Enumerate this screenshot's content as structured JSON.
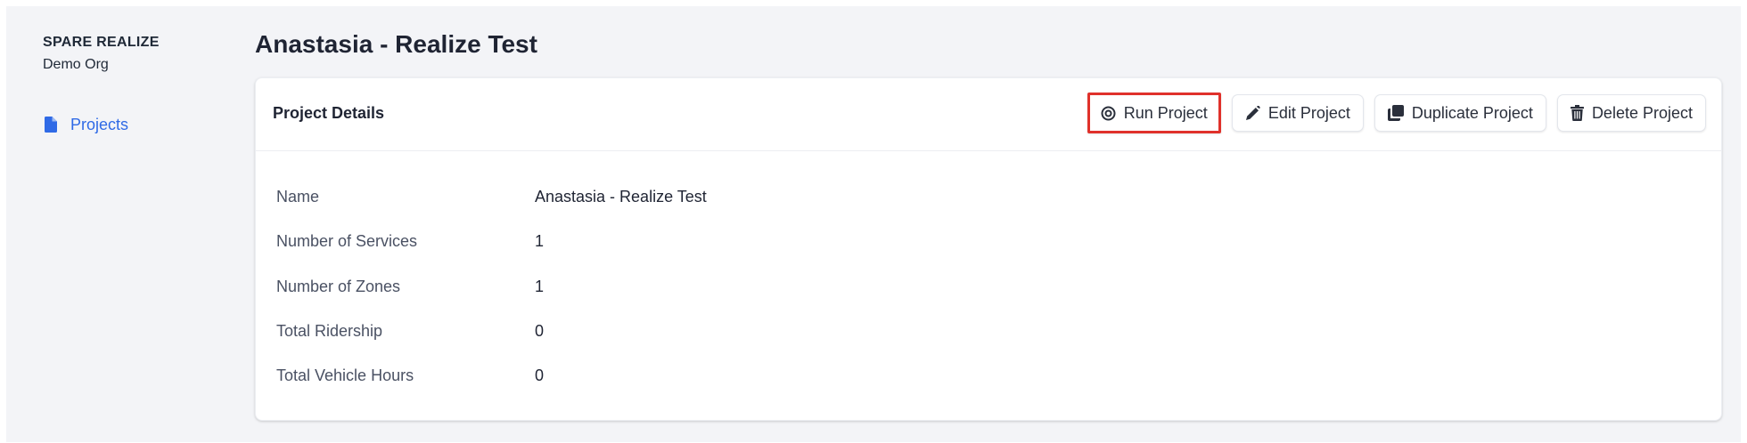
{
  "sidebar": {
    "org_name": "SPARE REALIZE",
    "org_sub": "Demo Org",
    "items": [
      {
        "label": "Projects",
        "icon": "file-icon",
        "active": true
      }
    ]
  },
  "page": {
    "title": "Anastasia - Realize Test"
  },
  "card": {
    "title": "Project Details",
    "actions": {
      "run": "Run Project",
      "edit": "Edit Project",
      "duplicate": "Duplicate Project",
      "delete": "Delete Project"
    },
    "details": [
      {
        "label": "Name",
        "value": "Anastasia - Realize Test"
      },
      {
        "label": "Number of Services",
        "value": "1"
      },
      {
        "label": "Number of Zones",
        "value": "1"
      },
      {
        "label": "Total Ridership",
        "value": "0"
      },
      {
        "label": "Total Vehicle Hours",
        "value": "0"
      }
    ]
  },
  "colors": {
    "accent": "#2f6ae6",
    "highlight": "#e0312b",
    "background": "#f3f4f7"
  }
}
